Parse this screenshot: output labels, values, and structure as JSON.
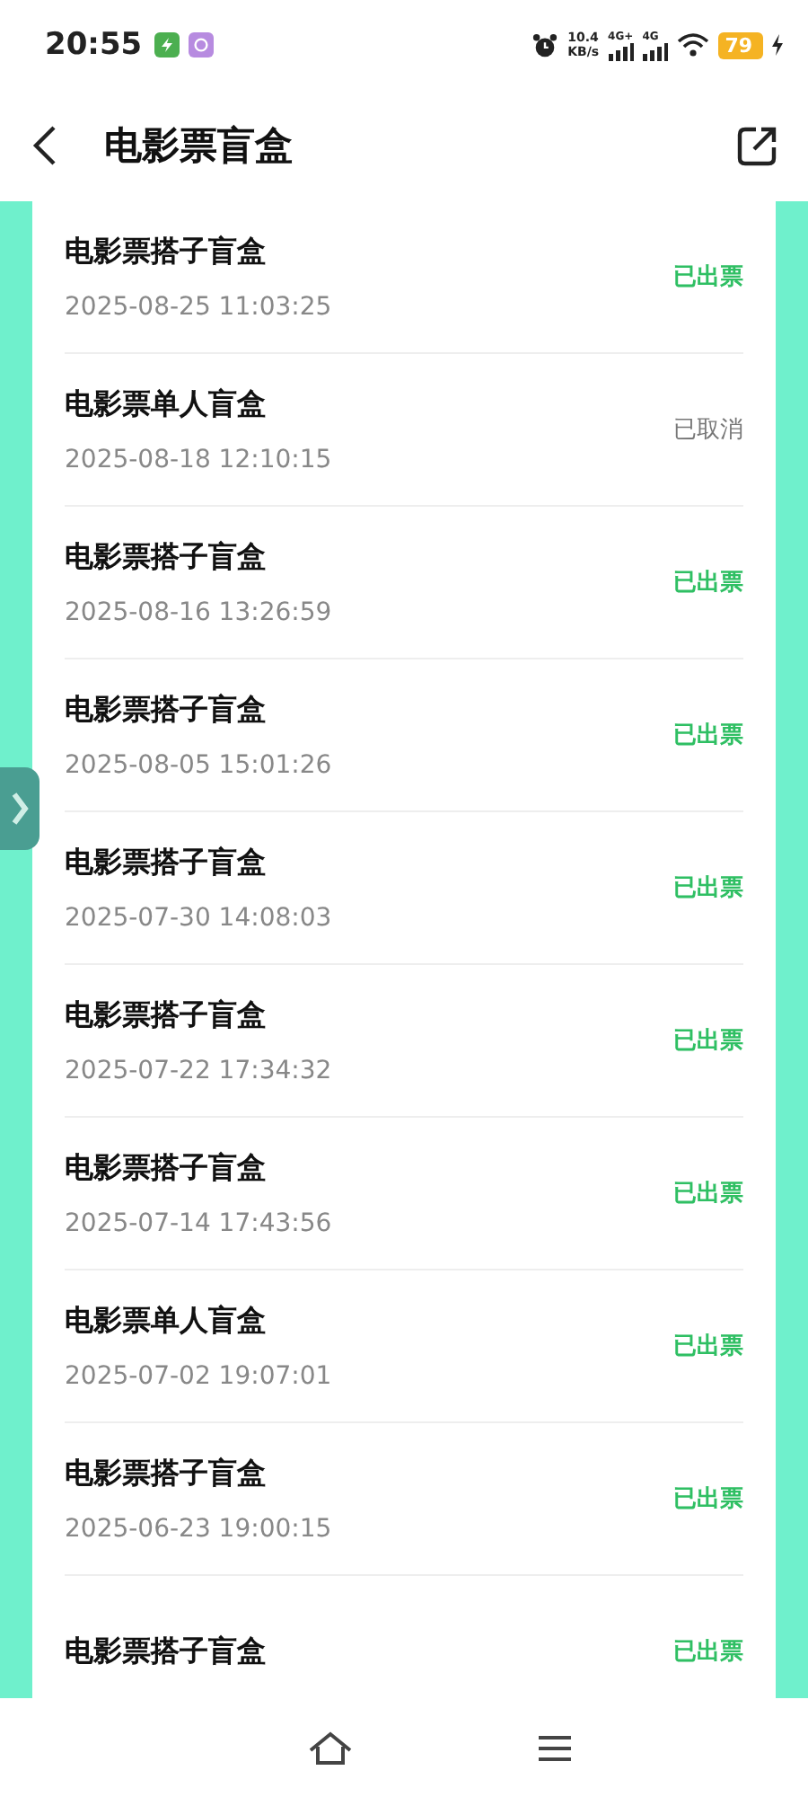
{
  "status_bar": {
    "time": "20:55",
    "net_speed": "10.4",
    "net_unit": "KB/s",
    "signals": [
      {
        "label": "4G+"
      },
      {
        "label": "4G"
      }
    ],
    "battery": "79",
    "charging": true
  },
  "header": {
    "title": "电影票盲盒"
  },
  "orders": [
    {
      "name": "电影票搭子盲盒",
      "date": "2025-08-25 11:03:25",
      "status": "已出票",
      "kind": "issued"
    },
    {
      "name": "电影票单人盲盒",
      "date": "2025-08-18 12:10:15",
      "status": "已取消",
      "kind": "cancelled"
    },
    {
      "name": "电影票搭子盲盒",
      "date": "2025-08-16 13:26:59",
      "status": "已出票",
      "kind": "issued"
    },
    {
      "name": "电影票搭子盲盒",
      "date": "2025-08-05 15:01:26",
      "status": "已出票",
      "kind": "issued"
    },
    {
      "name": "电影票搭子盲盒",
      "date": "2025-07-30 14:08:03",
      "status": "已出票",
      "kind": "issued"
    },
    {
      "name": "电影票搭子盲盒",
      "date": "2025-07-22 17:34:32",
      "status": "已出票",
      "kind": "issued"
    },
    {
      "name": "电影票搭子盲盒",
      "date": "2025-07-14 17:43:56",
      "status": "已出票",
      "kind": "issued"
    },
    {
      "name": "电影票单人盲盒",
      "date": "2025-07-02 19:07:01",
      "status": "已出票",
      "kind": "issued"
    },
    {
      "name": "电影票搭子盲盒",
      "date": "2025-06-23 19:00:15",
      "status": "已出票",
      "kind": "issued"
    },
    {
      "name": "电影票搭子盲盒",
      "status": "已出票",
      "kind": "issued"
    }
  ]
}
